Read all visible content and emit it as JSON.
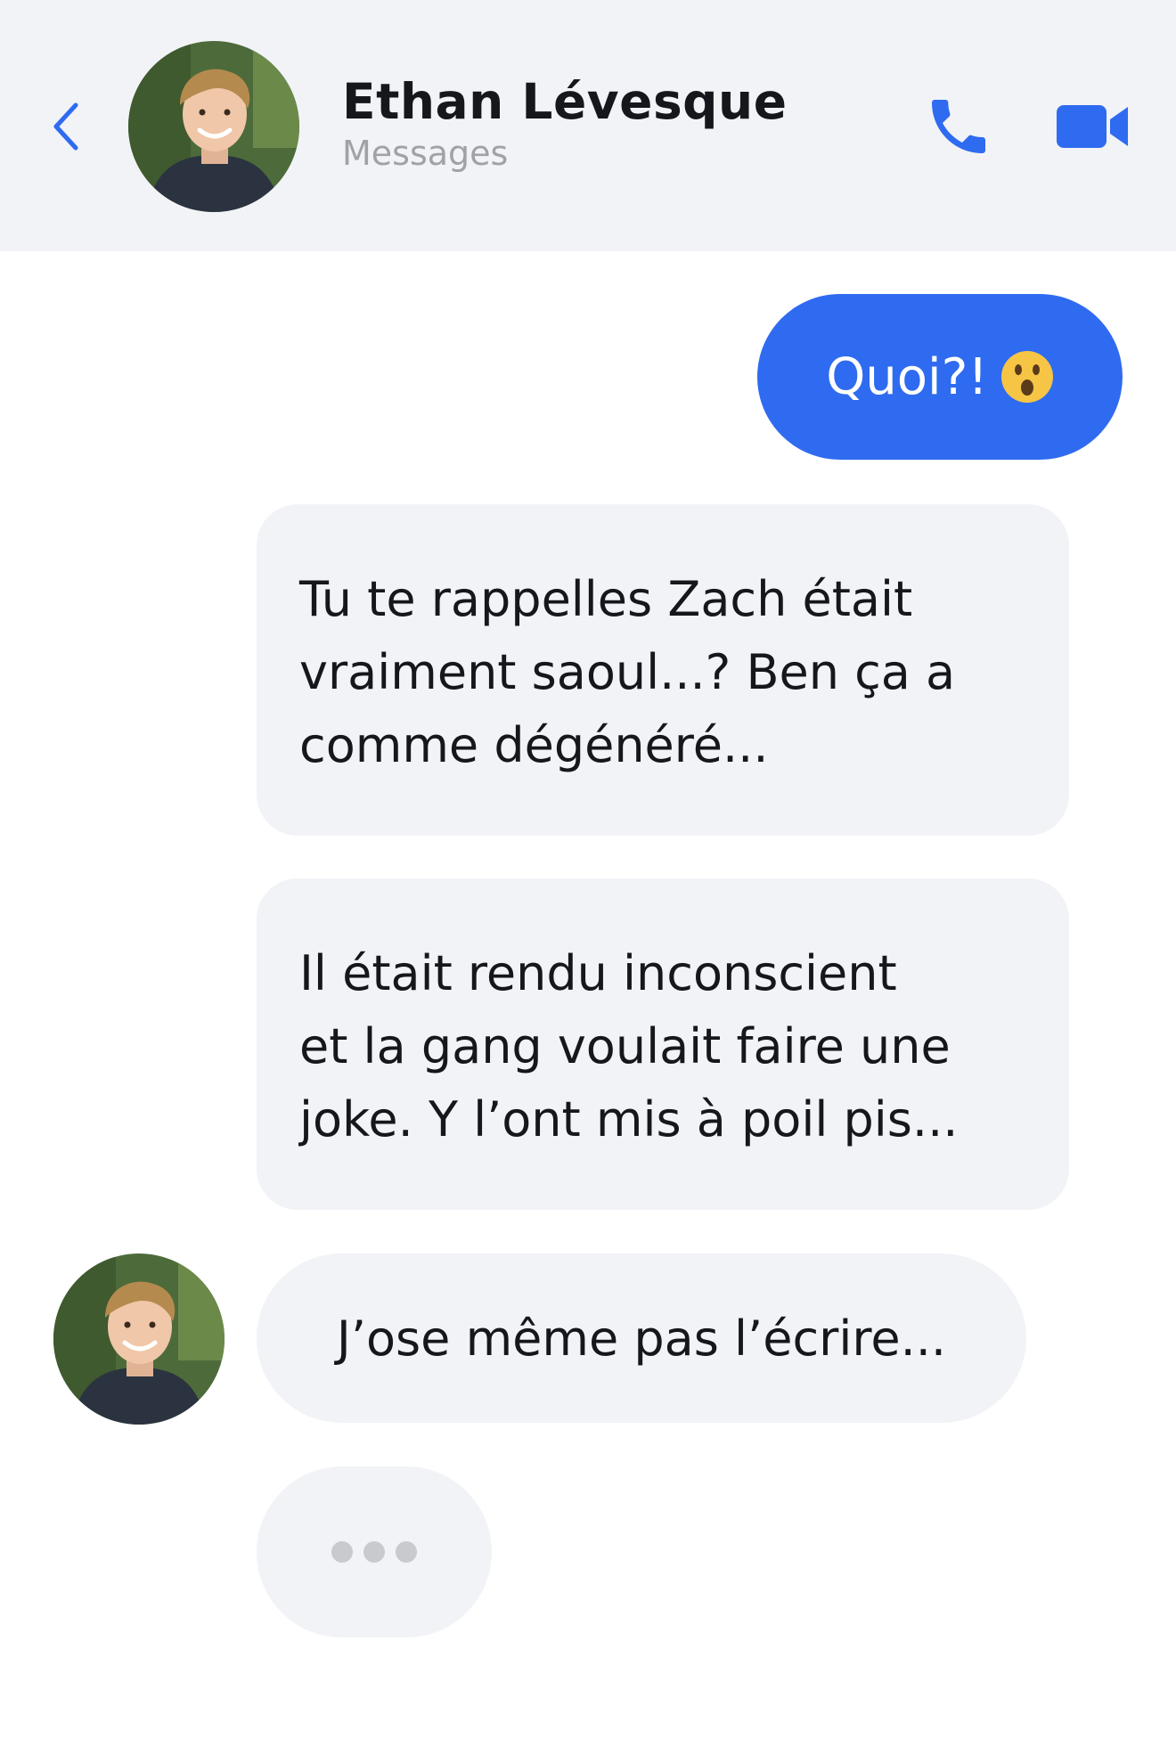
{
  "header": {
    "contact_name": "Ethan Lévesque",
    "subtitle": "Messages",
    "back_icon": "chevron-left-icon",
    "call_icon": "phone-icon",
    "video_icon": "video-camera-icon",
    "accent_color": "#2f6bf0"
  },
  "messages": [
    {
      "direction": "outgoing",
      "text": "Quoi?!",
      "emoji": "astonished-face-emoji"
    },
    {
      "direction": "incoming",
      "lines": [
        "Tu te rappelles Zach était",
        "vraiment saoul...? Ben ça a",
        "comme dégénéré..."
      ]
    },
    {
      "direction": "incoming",
      "lines": [
        "Il était rendu inconscient",
        "et la gang voulait faire une",
        "joke. Y l’ont mis à poil pis..."
      ]
    },
    {
      "direction": "incoming",
      "text": "J’ose même pas l’écrire..."
    }
  ],
  "typing_indicator": {
    "visible": true,
    "dots": 3
  },
  "colors": {
    "outgoing_bubble": "#2f6bf0",
    "incoming_bubble": "#f2f3f7",
    "header_background": "#f2f3f7",
    "subtitle_text": "#a0a2a8"
  }
}
